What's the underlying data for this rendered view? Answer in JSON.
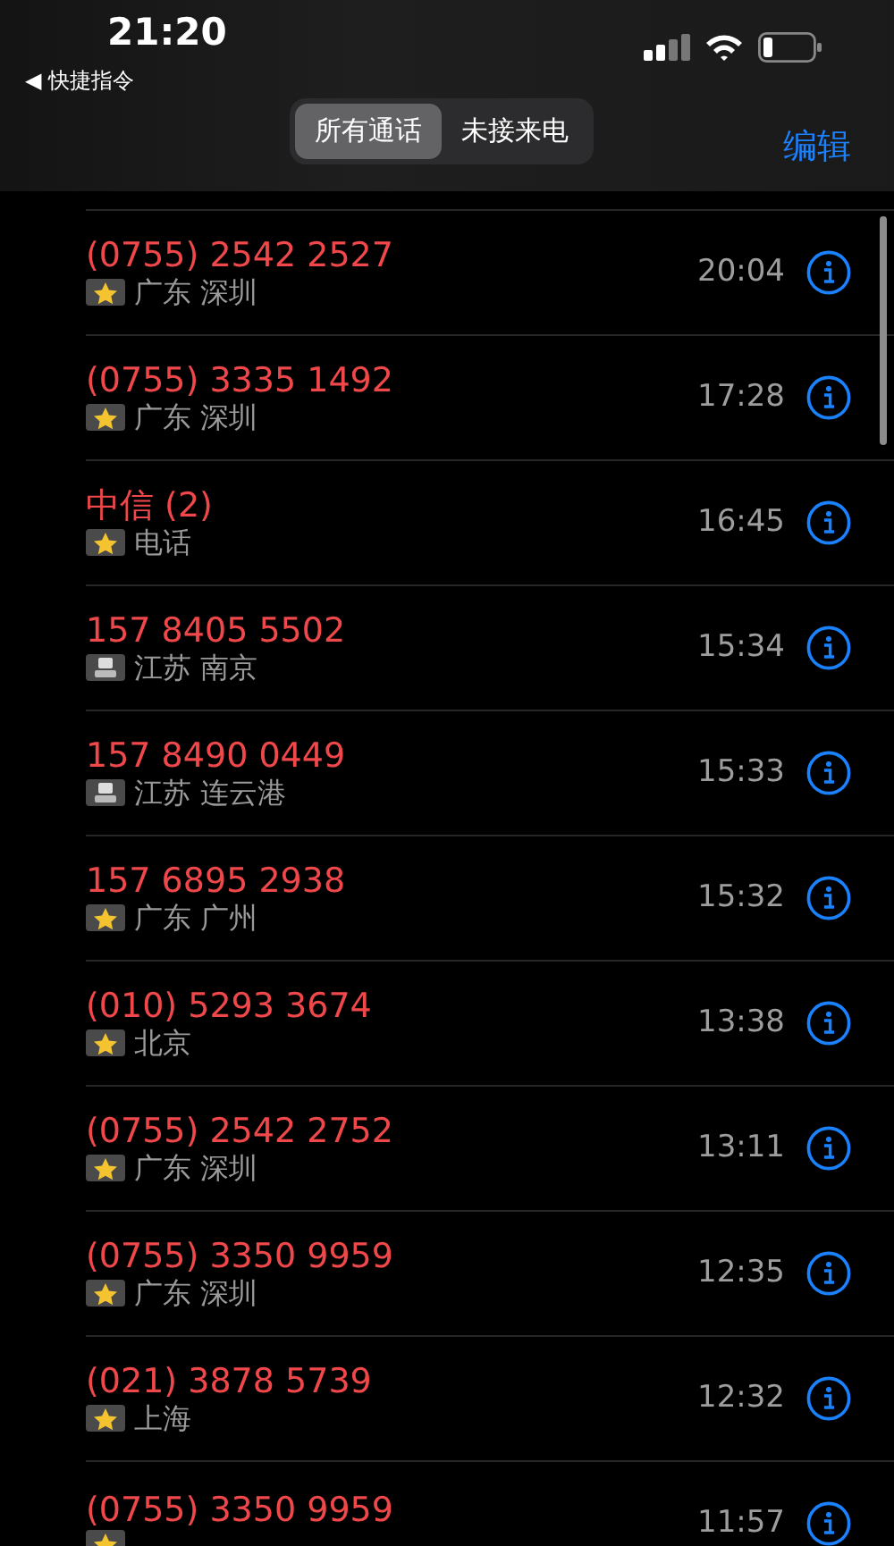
{
  "status_bar": {
    "time": "21:20",
    "back_link": "◀ 快捷指令"
  },
  "segments": [
    {
      "label": "所有通话",
      "selected": true
    },
    {
      "label": "未接来电",
      "selected": false
    }
  ],
  "edit_button": "编辑",
  "calls": [
    {
      "caller": "(0755) 2542 2527",
      "kind": "star",
      "location": "广东 深圳",
      "time": "20:04"
    },
    {
      "caller": "(0755) 3335 1492",
      "kind": "star",
      "location": "广东 深圳",
      "time": "17:28"
    },
    {
      "caller": "中信 (2)",
      "kind": "star",
      "location": "电话",
      "time": "16:45"
    },
    {
      "caller": "157 8405 5502",
      "kind": "device",
      "location": "江苏 南京",
      "time": "15:34"
    },
    {
      "caller": "157 8490 0449",
      "kind": "device",
      "location": "江苏 连云港",
      "time": "15:33"
    },
    {
      "caller": "157 6895 2938",
      "kind": "star",
      "location": "广东 广州",
      "time": "15:32"
    },
    {
      "caller": "(010) 5293 3674",
      "kind": "star",
      "location": "北京",
      "time": "13:38"
    },
    {
      "caller": "(0755) 2542 2752",
      "kind": "star",
      "location": "广东 深圳",
      "time": "13:11"
    },
    {
      "caller": "(0755) 3350 9959",
      "kind": "star",
      "location": "广东 深圳",
      "time": "12:35"
    },
    {
      "caller": "(021) 3878 5739",
      "kind": "star",
      "location": "上海",
      "time": "12:32"
    },
    {
      "caller": "(0755) 3350 9959",
      "kind": "star",
      "time": "11:57"
    }
  ]
}
